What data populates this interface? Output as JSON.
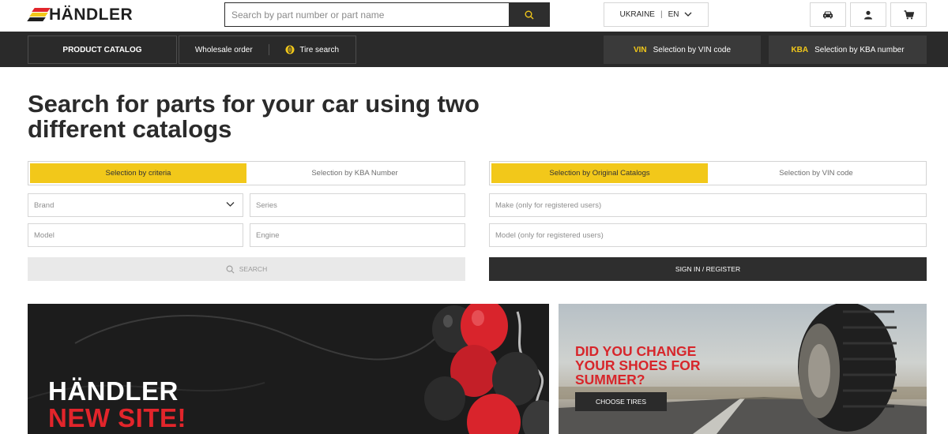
{
  "header": {
    "logo_text": "HÄNDLER",
    "search_placeholder": "Search by part number or part name",
    "country": "UKRAINE",
    "language": "EN",
    "icons": [
      "search-icon",
      "car-icon",
      "user-icon",
      "cart-icon",
      "chevron-down-icon"
    ]
  },
  "nav": {
    "catalog_label": "PRODUCT CATALOG",
    "wholesale_label": "Wholesale order",
    "tire_label": "Tire search",
    "vin_prefix": "VIN",
    "vin_label": "Selection by VIN code",
    "kba_prefix": "KBA",
    "kba_label": "Selection by KBA number"
  },
  "main": {
    "headline": "Search for parts for your car using two different catalogs",
    "left_panel": {
      "tabs": [
        "Selection by criteria",
        "Selection by KBA Number"
      ],
      "active_tab": 0,
      "brand_placeholder": "Brand",
      "series_placeholder": "Series",
      "model_placeholder": "Model",
      "engine_placeholder": "Engine",
      "search_label": "SEARCH"
    },
    "right_panel": {
      "tabs": [
        "Selection by Original Catalogs",
        "Selection by VIN code"
      ],
      "active_tab": 0,
      "make_placeholder": "Make (only for registered users)",
      "model_placeholder": "Model (only for registered users)",
      "signin_label": "SIGN IN / REGISTER"
    }
  },
  "banners": {
    "left_line1": "HÄNDLER",
    "left_line2": "NEW SITE!",
    "right_title": "DID YOU CHANGE YOUR SHOES FOR SUMMER?",
    "right_button": "CHOOSE TIRES"
  },
  "colors": {
    "accent_yellow": "#f2c81a",
    "dark": "#2a2a2a",
    "red": "#e2252b"
  }
}
